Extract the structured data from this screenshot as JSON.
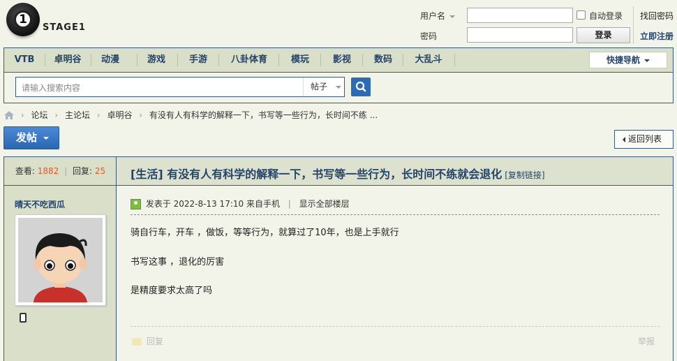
{
  "site": {
    "logo_numeral": "1",
    "logo_text": "STAGE1"
  },
  "login": {
    "username_label": "用户名",
    "password_label": "密码",
    "auto_login_label": "自动登录",
    "login_button": "登录",
    "find_password": "找回密码",
    "register": "立即注册"
  },
  "nav": {
    "items": [
      "VTB",
      "卓明谷",
      "动漫",
      "游戏",
      "手游",
      "八卦体育",
      "模玩",
      "影视",
      "数码",
      "大乱斗"
    ],
    "quick_nav": "快捷导航"
  },
  "search": {
    "placeholder": "请输入搜索内容",
    "type": "帖子"
  },
  "breadcrumb": [
    "论坛",
    "主论坛",
    "卓明谷",
    "有没有人有科学的解释一下，书写等一些行为，长时间不练 ..."
  ],
  "actions": {
    "post_button": "发帖",
    "back_button": "返回列表"
  },
  "thread": {
    "views_label": "查看:",
    "views": "1882",
    "replies_label": "回复:",
    "replies": "25",
    "title": "[生活] 有没有人有科学的解释一下，书写等一些行为，长时间不练就会退化",
    "copy_link": "[复制链接]"
  },
  "post": {
    "author": "晴天不吃西瓜",
    "meta_posted": "发表于 2022-8-13 17:10 来自手机",
    "meta_show_all": "显示全部楼层",
    "content": [
      "骑自行车，开车 ，做饭，等等行为，就算过了10年，也是上手就行",
      "书写这事 ，退化的厉害",
      "是精度要求太高了吗"
    ],
    "reply": "回复",
    "report": "举报"
  },
  "colors": {
    "accent": "#24446b",
    "border": "#3b5a7a",
    "bar": "#d9dfc9",
    "background": "#f3f4e9",
    "count": "#e05a28",
    "button": "#2c6cb7"
  }
}
